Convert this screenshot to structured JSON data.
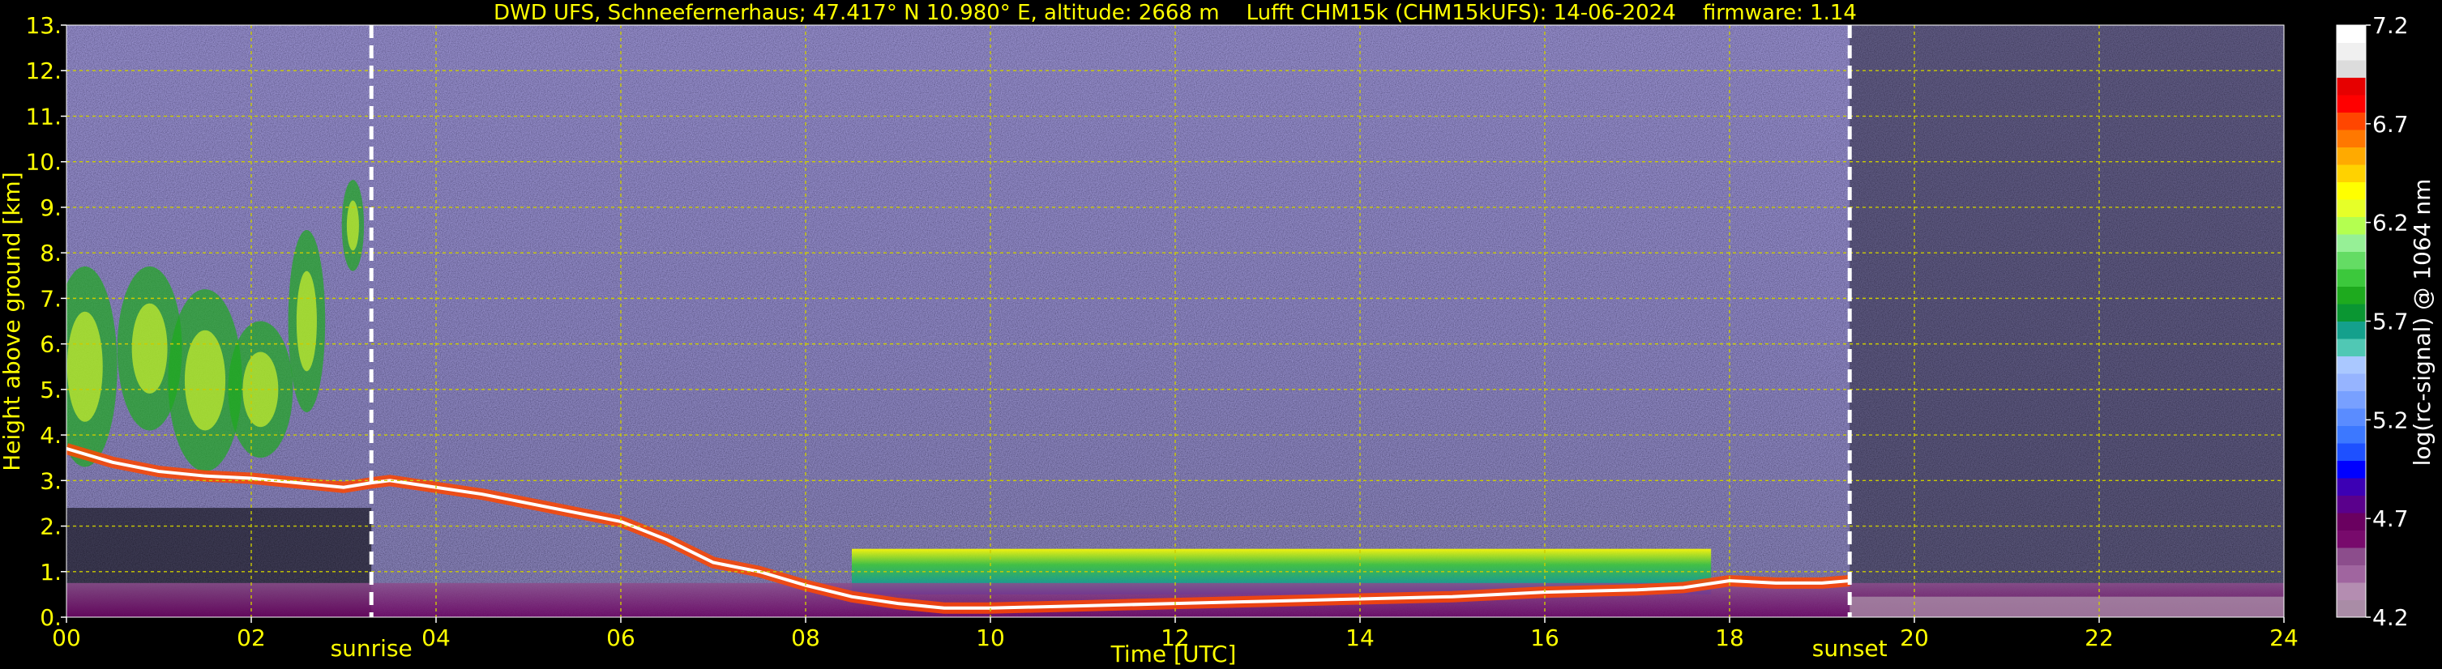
{
  "chart_data": {
    "type": "heatmap",
    "title": "DWD UFS, Schneefernerhaus; 47.417° N 10.980° E, altitude: 2668 m    Lufft CHM15k (CHM15kUFS): 14-06-2024    firmware: 1.14",
    "xlabel": "Time [UTC]",
    "ylabel": "Height above ground [km]",
    "xlim": [
      0,
      24
    ],
    "ylim": [
      0,
      13
    ],
    "x_ticks": [
      "00",
      "02",
      "04",
      "06",
      "08",
      "10",
      "12",
      "14",
      "16",
      "18",
      "20",
      "22",
      "24"
    ],
    "y_ticks": [
      "0.",
      "1.",
      "2.",
      "3.",
      "4.",
      "5.",
      "6.",
      "7.",
      "8.",
      "9.",
      "10.",
      "11.",
      "12.",
      "13."
    ],
    "grid": true,
    "annotations": [
      {
        "label": "sunrise",
        "x": 3.3
      },
      {
        "label": "sunset",
        "x": 19.3
      }
    ],
    "colorbar": {
      "label": "log(rc-signal) @ 1064 nm",
      "min": 4.2,
      "max": 7.2,
      "ticks": [
        "7.2",
        "6.7",
        "6.2",
        "5.7",
        "5.2",
        "4.7",
        "4.2"
      ],
      "tick_values": [
        7.2,
        6.7,
        6.2,
        5.7,
        5.2,
        4.7,
        4.2
      ],
      "colors": [
        "#a98ca6",
        "#b48db1",
        "#a0659f",
        "#8c4d8c",
        "#780a6c",
        "#6a0060",
        "#5a008c",
        "#3c00b4",
        "#0000ff",
        "#1e50ff",
        "#3c78ff",
        "#5a8cff",
        "#78a0ff",
        "#96b4ff",
        "#aac8ff",
        "#50c8b4",
        "#14a08c",
        "#0a9632",
        "#1eaa1e",
        "#3cc83c",
        "#64dc64",
        "#96f096",
        "#b4ff50",
        "#e6ff28",
        "#ffff00",
        "#ffd200",
        "#ffaa00",
        "#ff7800",
        "#ff4600",
        "#ff0000",
        "#e60000",
        "#dcdcdc",
        "#f0f0f0",
        "#ffffff"
      ]
    },
    "cloud_base_trace": [
      [
        0.0,
        3.7
      ],
      [
        0.5,
        3.4
      ],
      [
        1.0,
        3.2
      ],
      [
        1.5,
        3.1
      ],
      [
        2.0,
        3.05
      ],
      [
        2.5,
        2.95
      ],
      [
        3.0,
        2.85
      ],
      [
        3.3,
        2.95
      ],
      [
        3.5,
        3.0
      ],
      [
        4.0,
        2.85
      ],
      [
        4.5,
        2.7
      ],
      [
        5.0,
        2.5
      ],
      [
        5.5,
        2.3
      ],
      [
        6.0,
        2.1
      ],
      [
        6.5,
        1.7
      ],
      [
        7.0,
        1.2
      ],
      [
        7.5,
        1.0
      ],
      [
        8.0,
        0.7
      ],
      [
        8.5,
        0.45
      ],
      [
        9.0,
        0.3
      ],
      [
        9.5,
        0.2
      ],
      [
        10.0,
        0.2
      ],
      [
        11.0,
        0.25
      ],
      [
        12.0,
        0.3
      ],
      [
        13.0,
        0.35
      ],
      [
        14.0,
        0.4
      ],
      [
        15.0,
        0.45
      ],
      [
        16.0,
        0.55
      ],
      [
        17.0,
        0.6
      ],
      [
        17.5,
        0.65
      ],
      [
        18.0,
        0.8
      ],
      [
        18.5,
        0.75
      ],
      [
        19.0,
        0.75
      ],
      [
        19.3,
        0.8
      ]
    ]
  }
}
